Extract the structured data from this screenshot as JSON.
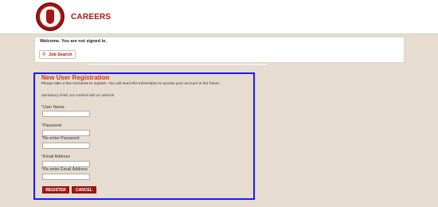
{
  "header": {
    "logo_alt": "Chipotle Mexican Grill",
    "title": "CAREERS",
    "brand_color": "#a81612"
  },
  "welcome": {
    "message": "Welcome. You are not signed in.",
    "job_search_label": "Job Search",
    "job_search_icon": "search-icon"
  },
  "registration": {
    "title": "New User Registration",
    "intro": "Please take a few moments to register. You will need this information to access your account in the future.",
    "note": "Mandatory fields are marked with an asterisk",
    "asterisk": "*",
    "fields": [
      {
        "label": "User Name",
        "value": ""
      },
      {
        "label": "Password",
        "value": ""
      },
      {
        "label": "Re-enter Password",
        "value": ""
      },
      {
        "label": "Email Address",
        "value": ""
      },
      {
        "label": "Re-enter Email Address",
        "value": ""
      }
    ],
    "register_label": "REGISTER",
    "cancel_label": "CANCEL",
    "highlight_color": "#1a1aff"
  }
}
